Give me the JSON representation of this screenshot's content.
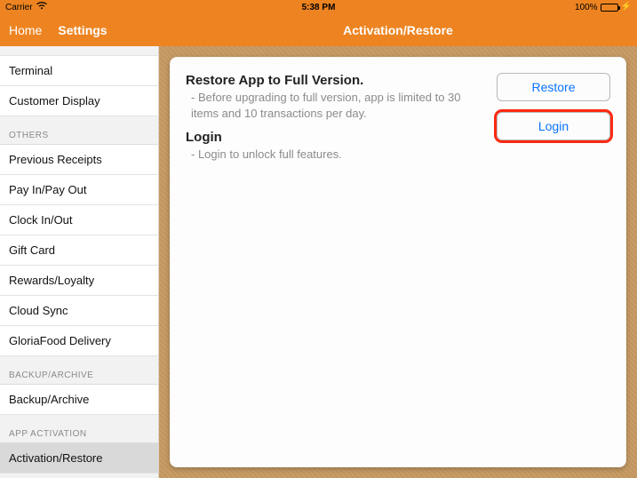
{
  "status": {
    "carrier": "Carrier",
    "time": "5:38 PM",
    "battery_pct": "100%"
  },
  "nav": {
    "back": "Home",
    "title_left": "Settings",
    "title_main": "Activation/Restore"
  },
  "sidebar": {
    "group1": [
      "Terminal",
      "Customer Display"
    ],
    "header_others": "OTHERS",
    "group_others": [
      "Previous Receipts",
      "Pay In/Pay Out",
      "Clock In/Out",
      "Gift Card",
      "Rewards/Loyalty",
      "Cloud Sync",
      "GloriaFood Delivery"
    ],
    "header_backup": "BACKUP/ARCHIVE",
    "group_backup": [
      "Backup/Archive"
    ],
    "header_activation": "APP ACTIVATION",
    "group_activation": [
      "Activation/Restore"
    ]
  },
  "content": {
    "restore_title": "Restore App to Full Version.",
    "restore_sub": " - Before upgrading to full version, app is limited to 30 items and 10 transactions per day.",
    "login_title": "Login",
    "login_sub": " - Login to unlock full features.",
    "btn_restore": "Restore",
    "btn_login": "Login"
  }
}
